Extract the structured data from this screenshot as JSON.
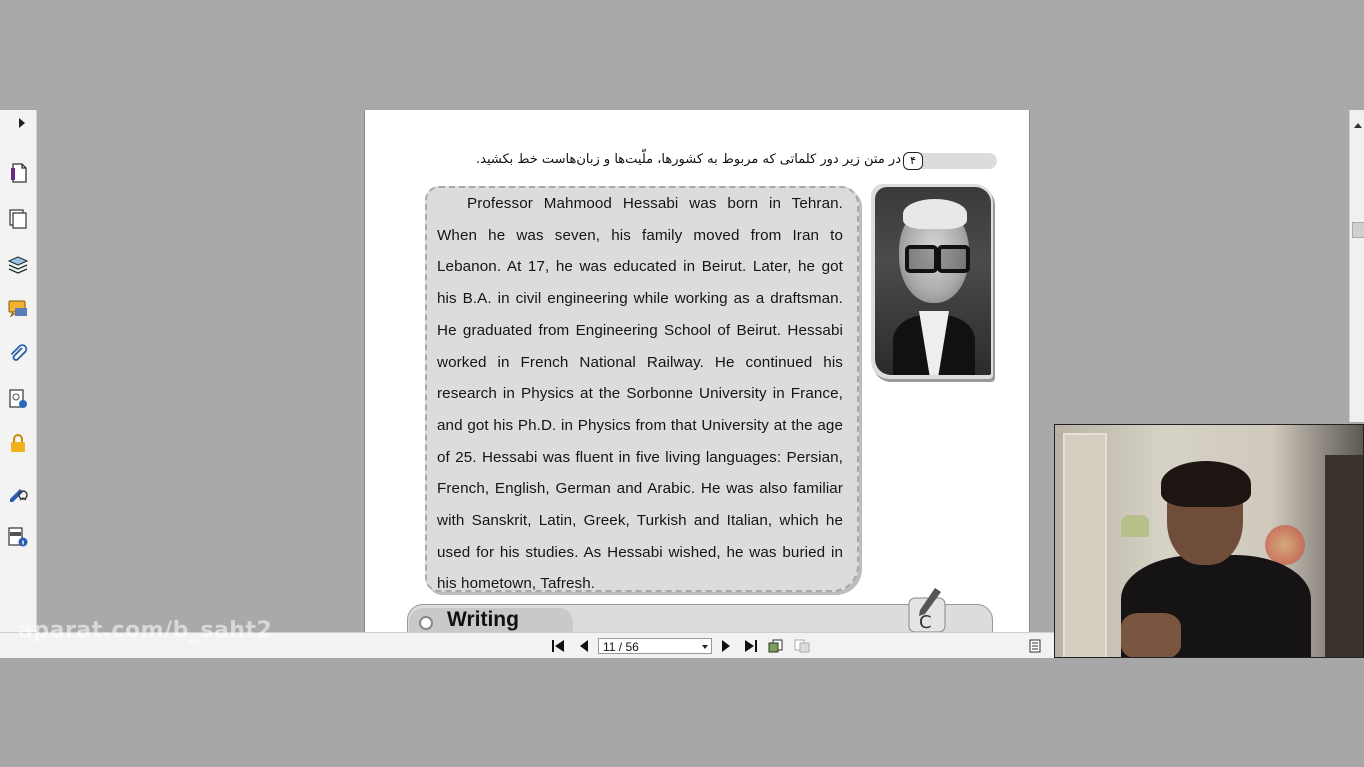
{
  "document": {
    "instruction_number": "۴",
    "instruction_text": "در متن زیر دور کلماتی که مربوط به کشورها، ملّیت‌ها و زبان‌هاست خط بکشید.",
    "reading_text": "Professor Mahmood Hessabi was born in Tehran. When he was seven, his family moved from Iran to Lebanon. At 17, he was educated in Beirut. Later, he got his B.A. in civil engineering while working as a draftsman. He graduated from Engineering School of Beirut. Hessabi worked in French National Railway. He continued his research in Physics at the Sorbonne University in France, and got his Ph.D. in Physics from that University at the age of 25. Hessabi was fluent in five living languages: Persian, French, English, German and Arabic. He was also familiar with Sanskrit, Latin, Greek, Turkish and Italian, which he used for his studies. As Hessabi wished, he was buried in his hometown, Tafresh.",
    "section_heading": "Writing"
  },
  "toolbar": {
    "page_indicator": "11 / 56"
  },
  "watermark": "aparat.com/b_saht2",
  "icons": {
    "sidebar": [
      "expand-arrow-icon",
      "page-thumbnail-icon",
      "pages-icon",
      "layers-icon",
      "comments-icon",
      "attachments-icon",
      "signature-icon",
      "lock-icon",
      "fill-sign-icon",
      "document-info-icon"
    ],
    "toolbar": [
      "first-page-icon",
      "previous-page-icon",
      "next-page-icon",
      "last-page-icon",
      "previous-view-icon",
      "next-view-icon",
      "page-display-icon"
    ]
  }
}
